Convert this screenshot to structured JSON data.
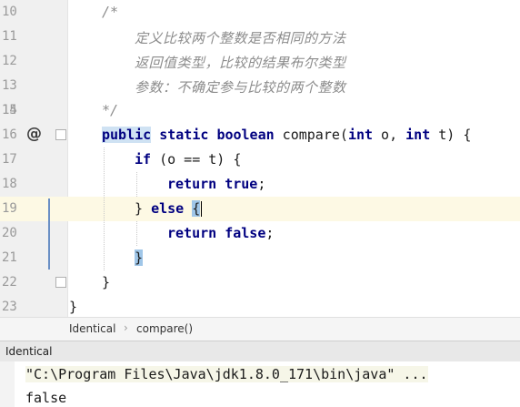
{
  "editor": {
    "lines": [
      {
        "number": "10",
        "text": "/*"
      },
      {
        "number": "11",
        "text": "定义比较两个整数是否相同的方法"
      },
      {
        "number": "12",
        "text": "返回值类型，比较的结果布尔类型"
      },
      {
        "number": "13",
        "text": "参数：不确定参与比较的两个整数"
      },
      {
        "number": "14",
        "text": ""
      },
      {
        "number": "15",
        "text": "*/"
      },
      {
        "number": "16",
        "text": "public static boolean compare(int o, int t) {"
      },
      {
        "number": "17",
        "text": "if (o == t) {"
      },
      {
        "number": "18",
        "text": "return true;"
      },
      {
        "number": "19",
        "text": "} else {"
      },
      {
        "number": "20",
        "text": "return false;"
      },
      {
        "number": "21",
        "text": "}"
      },
      {
        "number": "22",
        "text": "}"
      },
      {
        "number": "23",
        "text": "}"
      }
    ],
    "tokens": {
      "public": "public",
      "static": "static",
      "boolean": "boolean",
      "method_sig": " compare(",
      "int1": "int",
      "param1": " o, ",
      "int2": "int",
      "param2": " t) {",
      "if": "if",
      "cond": " (o == t) {",
      "return1": "return",
      "true": "true",
      "semi1": ";",
      "close_brace": "}",
      "else": "else",
      "open_brace": "{",
      "return2": "return",
      "false": "false",
      "semi2": ";",
      "method_close": "}",
      "class_close": "}"
    },
    "gutter_icon": "override-at-icon"
  },
  "breadcrumb": {
    "class_name": "Identical",
    "separator": "›",
    "method_name": "compare()"
  },
  "run_panel": {
    "tab_label": "Identical",
    "command": "\"C:\\Program Files\\Java\\jdk1.8.0_171\\bin\\java\" ...",
    "output": "false"
  },
  "colors": {
    "keyword": "#000080",
    "comment": "#8c8c8c",
    "current_line": "#fdf9e4",
    "brace_match": "#9fc6e8"
  }
}
